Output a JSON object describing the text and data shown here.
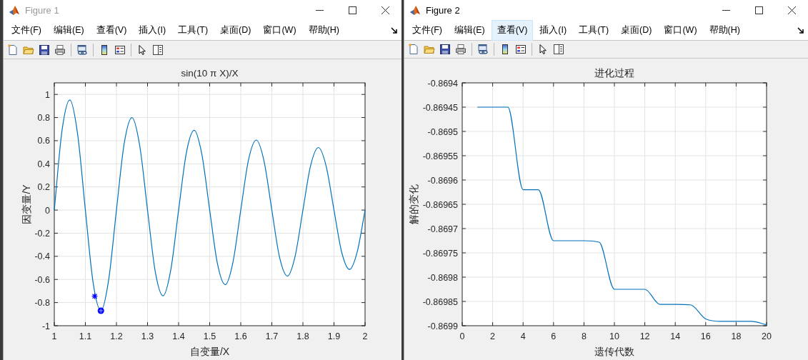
{
  "windows": [
    {
      "title": "Figure 1",
      "active": false,
      "menu": [
        {
          "label": "文件(F)",
          "highlighted": false
        },
        {
          "label": "编辑(E)",
          "highlighted": false
        },
        {
          "label": "查看(V)",
          "highlighted": false
        },
        {
          "label": "插入(I)",
          "highlighted": false
        },
        {
          "label": "工具(T)",
          "highlighted": false
        },
        {
          "label": "桌面(D)",
          "highlighted": false
        },
        {
          "label": "窗口(W)",
          "highlighted": false
        },
        {
          "label": "帮助(H)",
          "highlighted": false
        }
      ],
      "chart_data": {
        "type": "line",
        "title": "sin(10 π X)/X",
        "xlabel": "自变量/X",
        "ylabel": "因变量/Y",
        "x": [
          1,
          1.025,
          1.05,
          1.075,
          1.1,
          1.125,
          1.15,
          1.175,
          1.2,
          1.225,
          1.25,
          1.275,
          1.3,
          1.325,
          1.35,
          1.375,
          1.4,
          1.425,
          1.45,
          1.475,
          1.5,
          1.525,
          1.55,
          1.575,
          1.6,
          1.625,
          1.65,
          1.675,
          1.7,
          1.725,
          1.75,
          1.775,
          1.8,
          1.825,
          1.85,
          1.875,
          1.9,
          1.925,
          1.95,
          1.975,
          2
        ],
        "grid": true,
        "series": [
          {
            "color": "#0072bd",
            "values": [
              0,
              0.69,
              0.952,
              0.658,
              0,
              -0.629,
              -0.87,
              -0.602,
              0,
              0.577,
              0.8,
              0.555,
              0,
              -0.534,
              -0.741,
              -0.514,
              0,
              0.496,
              0.69,
              0.479,
              0,
              -0.464,
              -0.645,
              -0.449,
              0,
              0.435,
              0.606,
              0.422,
              0,
              -0.41,
              -0.571,
              -0.398,
              0,
              0.387,
              0.541,
              0.377,
              0,
              -0.367,
              -0.513,
              -0.358,
              0
            ]
          },
          {
            "type": "scatter",
            "marker": "cross",
            "color": "#0000ff",
            "x": [
              1.13
            ],
            "values": [
              -0.745
            ]
          },
          {
            "type": "scatter",
            "marker": "circle",
            "color": "#0000ff",
            "x": [
              1.15
            ],
            "values": [
              -0.87
            ]
          }
        ],
        "xlim": [
          1,
          2
        ],
        "ylim": [
          -1,
          1.1
        ],
        "xticks": [
          1,
          1.1,
          1.2,
          1.3,
          1.4,
          1.5,
          1.6,
          1.7,
          1.8,
          1.9,
          2
        ],
        "yticks": [
          -1,
          -0.8,
          -0.6,
          -0.4,
          -0.2,
          0,
          0.2,
          0.4,
          0.6,
          0.8,
          1
        ]
      }
    },
    {
      "title": "Figure 2",
      "active": true,
      "menu": [
        {
          "label": "文件(F)",
          "highlighted": false
        },
        {
          "label": "编辑(E)",
          "highlighted": false
        },
        {
          "label": "查看(V)",
          "highlighted": true
        },
        {
          "label": "插入(I)",
          "highlighted": false
        },
        {
          "label": "工具(T)",
          "highlighted": false
        },
        {
          "label": "桌面(D)",
          "highlighted": false
        },
        {
          "label": "窗口(W)",
          "highlighted": false
        },
        {
          "label": "帮助(H)",
          "highlighted": false
        }
      ],
      "chart_data": {
        "type": "line",
        "title": "进化过程",
        "xlabel": "遗传代数",
        "ylabel": "解的变化",
        "x": [
          1,
          2,
          3,
          4,
          5,
          6,
          7,
          8,
          9,
          10,
          11,
          12,
          13,
          14,
          15,
          16,
          17,
          18,
          19,
          20
        ],
        "grid": true,
        "series": [
          {
            "color": "#0072bd",
            "values": [
              -0.86945,
              -0.86945,
              -0.86945,
              -0.86962,
              -0.86962,
              -0.869725,
              -0.869725,
              -0.869725,
              -0.869728,
              -0.869825,
              -0.869825,
              -0.869825,
              -0.869856,
              -0.869856,
              -0.869857,
              -0.869886,
              -0.869891,
              -0.869891,
              -0.869891,
              -0.869898
            ]
          }
        ],
        "xlim": [
          0,
          20
        ],
        "ylim": [
          -0.8699,
          -0.8694
        ],
        "xticks": [
          0,
          2,
          4,
          6,
          8,
          10,
          12,
          14,
          16,
          18,
          20
        ],
        "yticks": [
          -0.8699,
          -0.86985,
          -0.8698,
          -0.86975,
          -0.8697,
          -0.86965,
          -0.8696,
          -0.86955,
          -0.8695,
          -0.86945,
          -0.8694
        ]
      }
    }
  ]
}
